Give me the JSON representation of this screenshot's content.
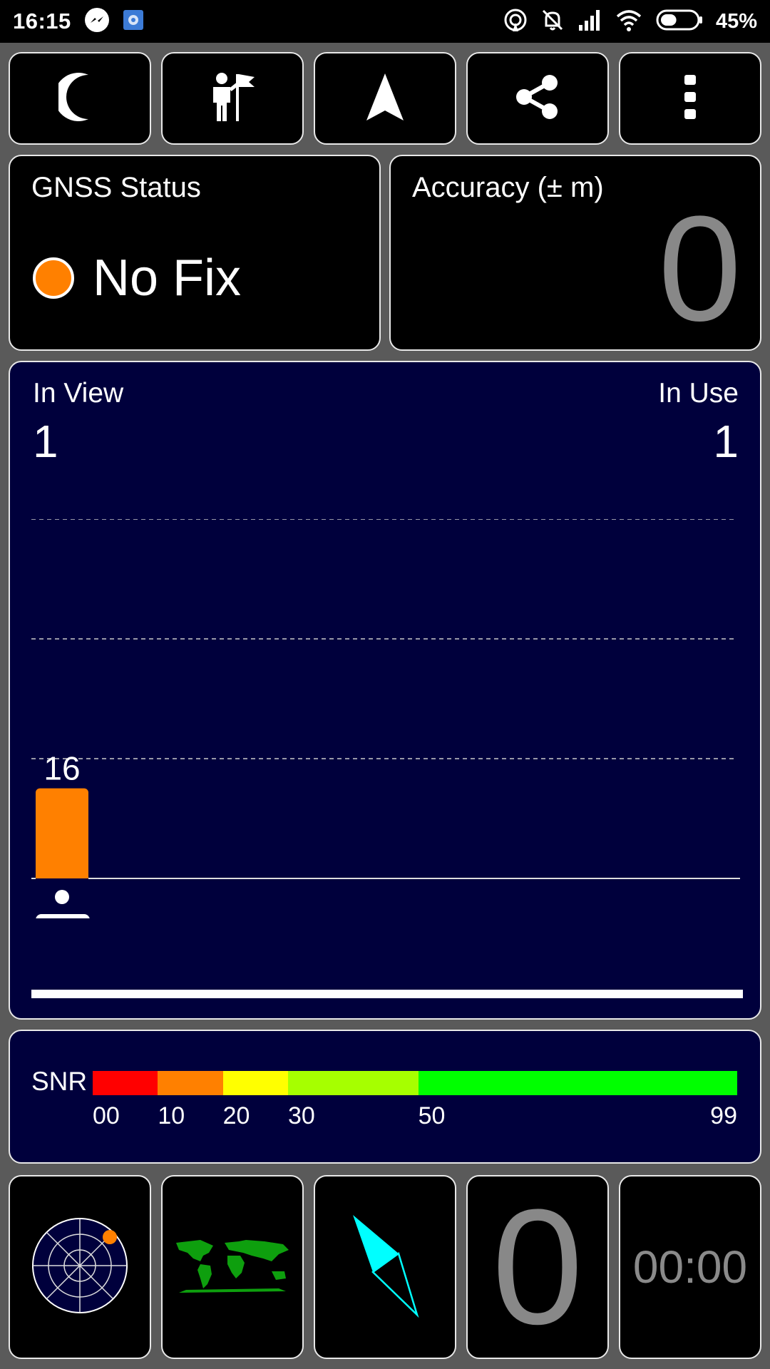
{
  "status_bar": {
    "time": "16:15",
    "battery_percent": "45%",
    "battery_level": 0.45
  },
  "toolbar": {
    "buttons": [
      {
        "icon": "moon-icon",
        "name": "night-mode-button"
      },
      {
        "icon": "person-flag-icon",
        "name": "waypoint-button"
      },
      {
        "icon": "navigation-arrow-icon",
        "name": "navigate-button"
      },
      {
        "icon": "share-icon",
        "name": "share-button"
      },
      {
        "icon": "more-vertical-icon",
        "name": "more-menu-button"
      }
    ]
  },
  "gnss_status": {
    "title": "GNSS Status",
    "status": "No Fix",
    "dot_color": "#ff8000"
  },
  "accuracy": {
    "title": "Accuracy (± m)",
    "value": "0"
  },
  "satellites": {
    "in_view_label": "In View",
    "in_view_value": "1",
    "in_use_label": "In Use",
    "in_use_value": "1",
    "bars": [
      {
        "snr": 16,
        "snr_label": "16",
        "prn": "10",
        "color": "#ff8000"
      }
    ]
  },
  "snr_scale": {
    "label": "SNR",
    "ticks": [
      {
        "value": 0,
        "label": "00"
      },
      {
        "value": 10,
        "label": "10"
      },
      {
        "value": 20,
        "label": "20"
      },
      {
        "value": 30,
        "label": "30"
      },
      {
        "value": 50,
        "label": "50"
      },
      {
        "value": 99,
        "label": "99"
      }
    ],
    "segments": [
      {
        "from": 0,
        "to": 10,
        "color": "#ff0000"
      },
      {
        "from": 10,
        "to": 20,
        "color": "#ff8000"
      },
      {
        "from": 20,
        "to": 30,
        "color": "#ffff00"
      },
      {
        "from": 30,
        "to": 50,
        "color": "#a6ff00"
      },
      {
        "from": 50,
        "to": 99,
        "color": "#00ff00"
      }
    ]
  },
  "bottom_bar": {
    "big_zero": "0",
    "clock": "00:00"
  },
  "colors": {
    "accent": "#ff8000",
    "panel_navy": "#00003c",
    "compass_cyan": "#00ffff",
    "map_green": "#0e9f0e"
  }
}
